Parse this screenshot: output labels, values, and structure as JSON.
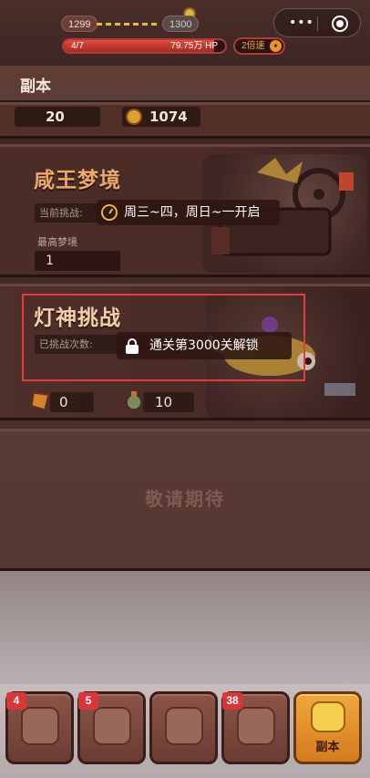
{
  "status_bar": {
    "current_stage": "1299",
    "next_stage": "1300",
    "hp_progress_label": "4/7",
    "hp_value": "79.75万 HP",
    "hp_fill_fraction": 0.93,
    "speed_button": "2倍速",
    "speed_icon": "✦"
  },
  "page": {
    "title": "副本"
  },
  "top_card": {
    "stat_left": "20",
    "stat_right": "1074"
  },
  "xianwang_card": {
    "title": "咸王梦境",
    "current_challenge_label": "当前挑战:",
    "notice": "周三~四，周日~一开启",
    "best_label": "最高梦境",
    "best_value": "1"
  },
  "dengshen_card": {
    "title": "灯神挑战",
    "attempts_label": "已挑战次数:",
    "lock_notice": "通关第3000关解锁",
    "reward_left": "0",
    "reward_right": "10"
  },
  "coming_soon": {
    "label": "敬请期待"
  },
  "bottom_nav": {
    "items": [
      {
        "badge": "4"
      },
      {
        "badge": "5"
      },
      {
        "badge": ""
      },
      {
        "badge": "38"
      },
      {
        "label": "副本"
      }
    ]
  },
  "colors": {
    "highlight": "#e63b3b",
    "hp_red": "#e24b3d",
    "accent_orange": "#f0a73a"
  }
}
